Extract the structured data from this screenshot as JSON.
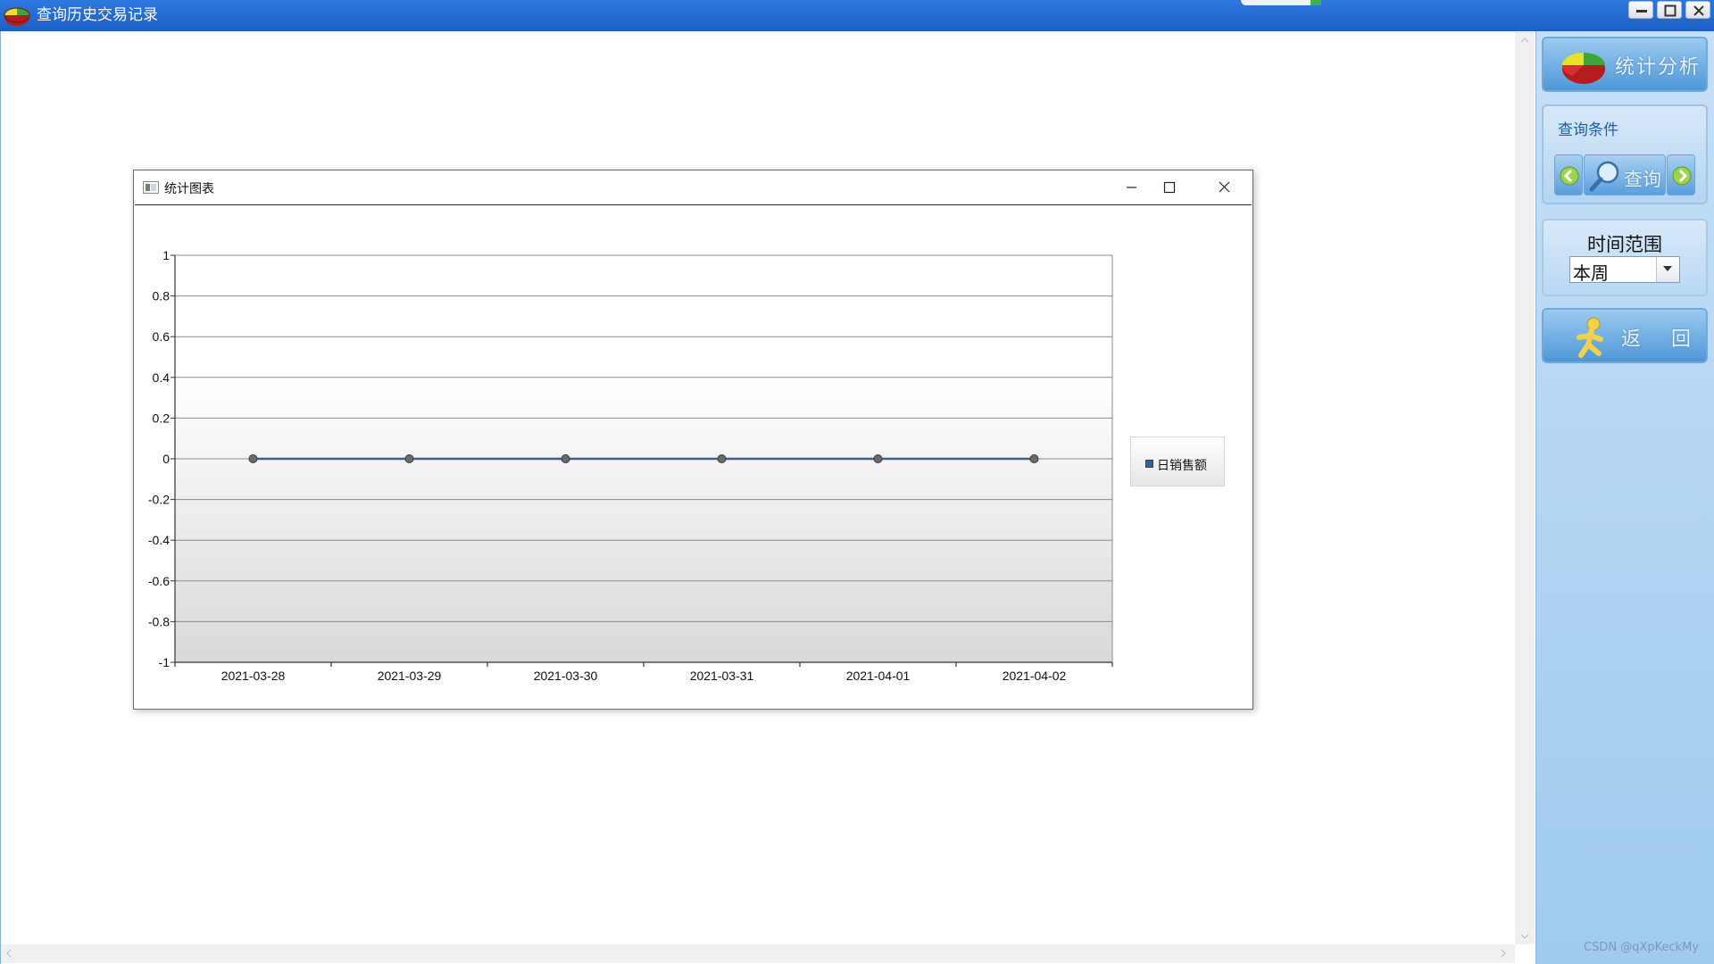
{
  "window": {
    "title": "查询历史交易记录"
  },
  "chart_window": {
    "title": "统计图表"
  },
  "side_panel": {
    "stats_label": "统计分析",
    "query_caption": "查询条件",
    "query_label": "查询",
    "range_caption": "时间范围",
    "range_value": "本周",
    "back_label": "返回"
  },
  "watermark": "CSDN @qXpKeckMy",
  "colors": {
    "titlebar": "#1d5fc6",
    "series_line": "#3e5f8a",
    "side_panel": "#b2d4f2"
  },
  "icons": {
    "app": "pie-chart-icon",
    "stats": "pie-chart-icon",
    "query": "magnifier-icon",
    "prev": "arrow-left-icon",
    "next": "arrow-right-icon",
    "back": "running-person-icon"
  },
  "chart_data": {
    "type": "line",
    "categories": [
      "2021-03-28",
      "2021-03-29",
      "2021-03-30",
      "2021-03-31",
      "2021-04-01",
      "2021-04-02"
    ],
    "series": [
      {
        "name": "日销售额",
        "values": [
          0,
          0,
          0,
          0,
          0,
          0
        ]
      }
    ],
    "y_ticks": [
      "1",
      "0.8",
      "0.6",
      "0.4",
      "0.2",
      "0",
      "-0.2",
      "-0.4",
      "-0.6",
      "-0.8",
      "-1"
    ],
    "ylim": [
      -1,
      1
    ],
    "grid": true,
    "legend_position": "right"
  }
}
